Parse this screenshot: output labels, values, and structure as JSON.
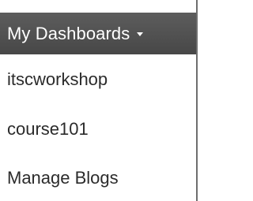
{
  "menu": {
    "title": "My Dashboards",
    "caret_icon": "caret-down-icon",
    "items": [
      {
        "label": "itscworkshop"
      },
      {
        "label": "course101"
      },
      {
        "label": "Manage Blogs"
      }
    ]
  },
  "colors": {
    "header_background": "#4f4f4f",
    "header_text": "#ffffff",
    "item_text": "#2b2b2b",
    "border": "#6e6e6e"
  }
}
